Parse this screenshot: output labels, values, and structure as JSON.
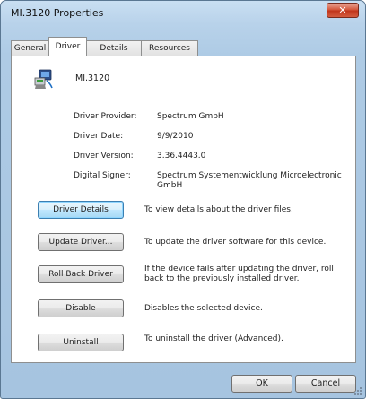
{
  "window": {
    "title": "MI.3120 Properties",
    "close_label": "✕"
  },
  "tabs": [
    {
      "label": "General",
      "active": false
    },
    {
      "label": "Driver",
      "active": true
    },
    {
      "label": "Details",
      "active": false
    },
    {
      "label": "Resources",
      "active": false
    }
  ],
  "device": {
    "icon": "network-adapter-icon",
    "name": "MI.3120"
  },
  "properties": {
    "provider_label": "Driver Provider:",
    "provider_value": "Spectrum GmbH",
    "date_label": "Driver Date:",
    "date_value": "9/9/2010",
    "version_label": "Driver Version:",
    "version_value": "3.36.4443.0",
    "signer_label": "Digital Signer:",
    "signer_value": "Spectrum Systementwicklung Microelectronic GmbH"
  },
  "actions": {
    "details_label": "Driver Details",
    "details_desc": "To view details about the driver files.",
    "update_label": "Update Driver...",
    "update_desc": "To update the driver software for this device.",
    "rollback_label": "Roll Back Driver",
    "rollback_desc": "If the device fails after updating the driver, roll back to the previously installed driver.",
    "disable_label": "Disable",
    "disable_desc": "Disables the selected device.",
    "uninstall_label": "Uninstall",
    "uninstall_desc": "To uninstall the driver (Advanced)."
  },
  "footer": {
    "ok_label": "OK",
    "cancel_label": "Cancel"
  }
}
